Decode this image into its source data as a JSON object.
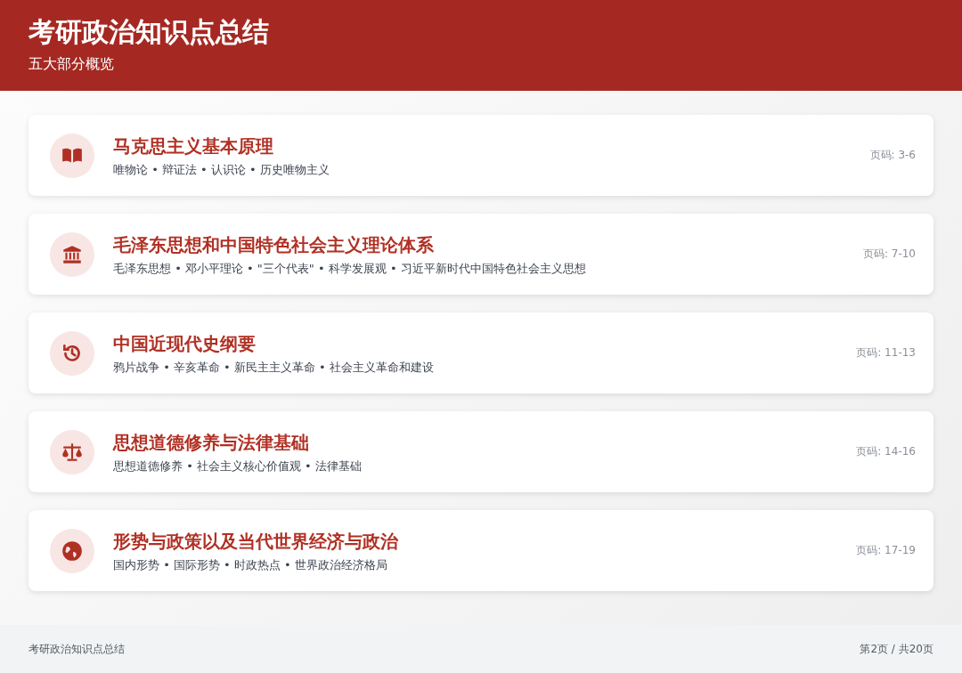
{
  "header": {
    "title": "考研政治知识点总结",
    "subtitle": "五大部分概览"
  },
  "sections": [
    {
      "kind": "book",
      "title": "马克思主义基本原理",
      "topics": "唯物论 • 辩证法 • 认识论 • 历史唯物主义",
      "pages": "页码: 3-6"
    },
    {
      "kind": "building",
      "title": "毛泽东思想和中国特色社会主义理论体系",
      "topics": "毛泽东思想 • 邓小平理论 • \"三个代表\" • 科学发展观 • 习近平新时代中国特色社会主义思想",
      "pages": "页码: 7-10"
    },
    {
      "kind": "history",
      "title": "中国近现代史纲要",
      "topics": "鸦片战争 • 辛亥革命 • 新民主主义革命 • 社会主义革命和建设",
      "pages": "页码: 11-13"
    },
    {
      "kind": "scale",
      "title": "思想道德修养与法律基础",
      "topics": "思想道德修养 • 社会主义核心价值观 • 法律基础",
      "pages": "页码: 14-16"
    },
    {
      "kind": "globe",
      "title": "形势与政策以及当代世界经济与政治",
      "topics": "国内形势 • 国际形势 • 时政热点 • 世界政治经济格局",
      "pages": "页码: 17-19"
    }
  ],
  "footer": {
    "left": "考研政治知识点总结",
    "right": "第2页 / 共20页"
  }
}
